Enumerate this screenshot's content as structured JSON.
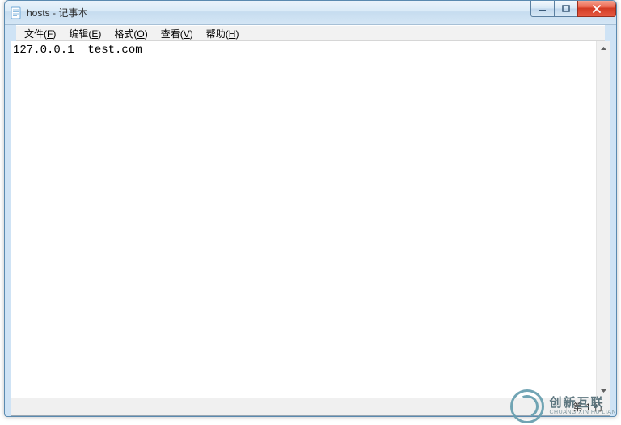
{
  "window": {
    "title": "hosts - 记事本"
  },
  "menus": {
    "file": {
      "label": "文件",
      "hotkey": "F"
    },
    "edit": {
      "label": "编辑",
      "hotkey": "E"
    },
    "format": {
      "label": "格式",
      "hotkey": "O"
    },
    "view": {
      "label": "查看",
      "hotkey": "V"
    },
    "help": {
      "label": "帮助",
      "hotkey": "H"
    }
  },
  "editor": {
    "content": "127.0.0.1  test.com"
  },
  "statusbar": {
    "position": "第 1 行"
  },
  "watermark": {
    "cn": "创新互联",
    "en": "CHUANG XIN HU LIAN"
  }
}
